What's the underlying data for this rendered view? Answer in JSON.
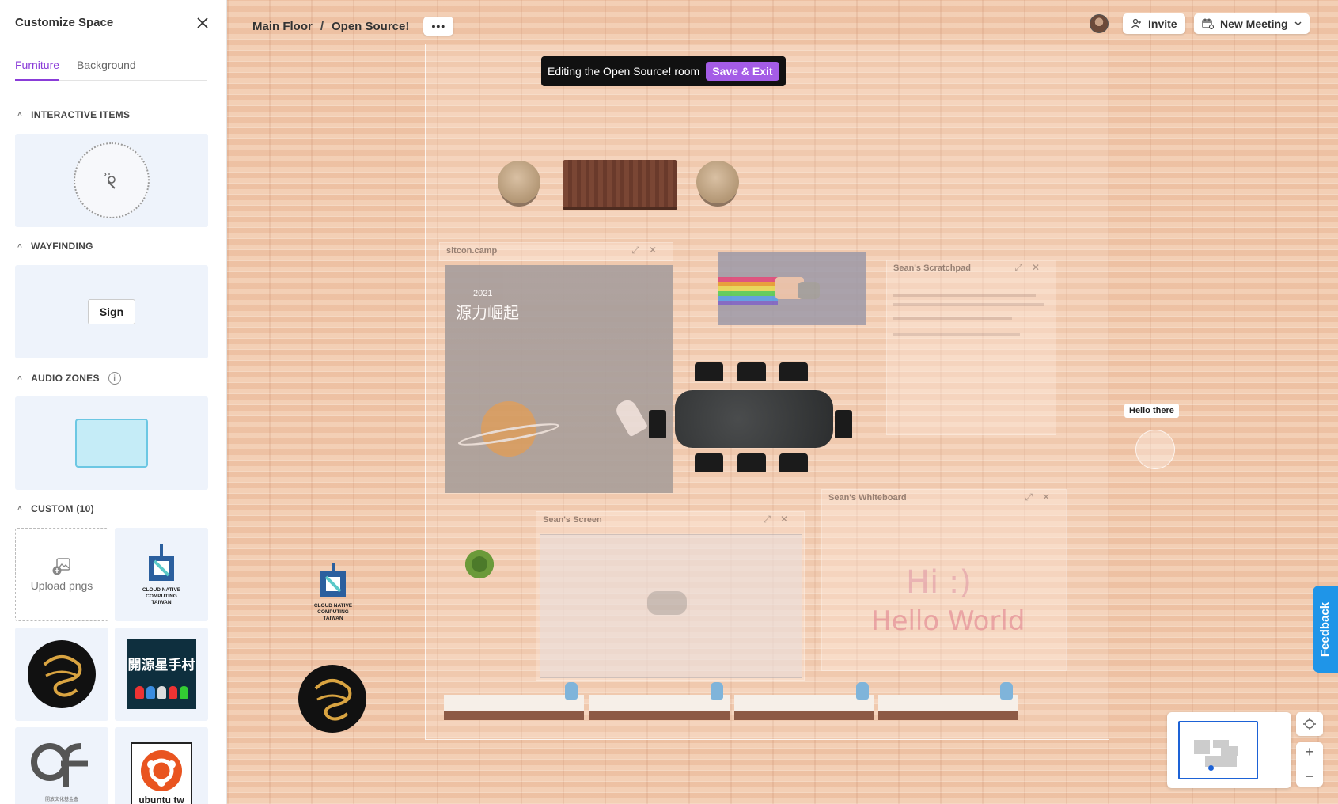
{
  "sidebar": {
    "title": "Customize Space",
    "tabs": [
      "Furniture",
      "Background"
    ],
    "sections": {
      "interactive": "INTERACTIVE ITEMS",
      "wayfinding": "WAYFINDING",
      "sign_label": "Sign",
      "audio": "AUDIO ZONES",
      "custom": "CUSTOM (10)",
      "upload_label": "Upload pngs"
    }
  },
  "topbar": {
    "crumb_floor": "Main Floor",
    "crumb_sep": "/",
    "crumb_room": "Open Source!",
    "more": "•••",
    "invite_label": "Invite",
    "meeting_label": "New Meeting"
  },
  "banner": {
    "text": "Editing the Open Source! room",
    "save_label": "Save & Exit"
  },
  "canvas": {
    "windows": {
      "sitcon": "sitcon.camp",
      "scratchpad": "Sean's Scratchpad",
      "screen": "Sean's Screen",
      "whiteboard": "Sean's Whiteboard"
    },
    "sitcon_year": "2021",
    "sitcon_heading": "源力崛起",
    "whiteboard_text1": "Hi :)",
    "whiteboard_text2": "Hello World",
    "hello_tag": "Hello there",
    "logo_text": "CLOUD NATIVE COMPUTING TAIWAN"
  },
  "custom_tiles": {
    "cncf_text": "CLOUD NATIVE COMPUTING TAIWAN",
    "village_text": "開源星手村",
    "ocf_text": "開放文化基金會",
    "ubuntu_text": "ubuntu tw"
  },
  "feedback_label": "Feedback",
  "colors": {
    "accent": "#8a3cd8",
    "save_button": "#a45ce6",
    "feedback": "#1f95e8",
    "minimap_frame": "#1d62d6"
  }
}
